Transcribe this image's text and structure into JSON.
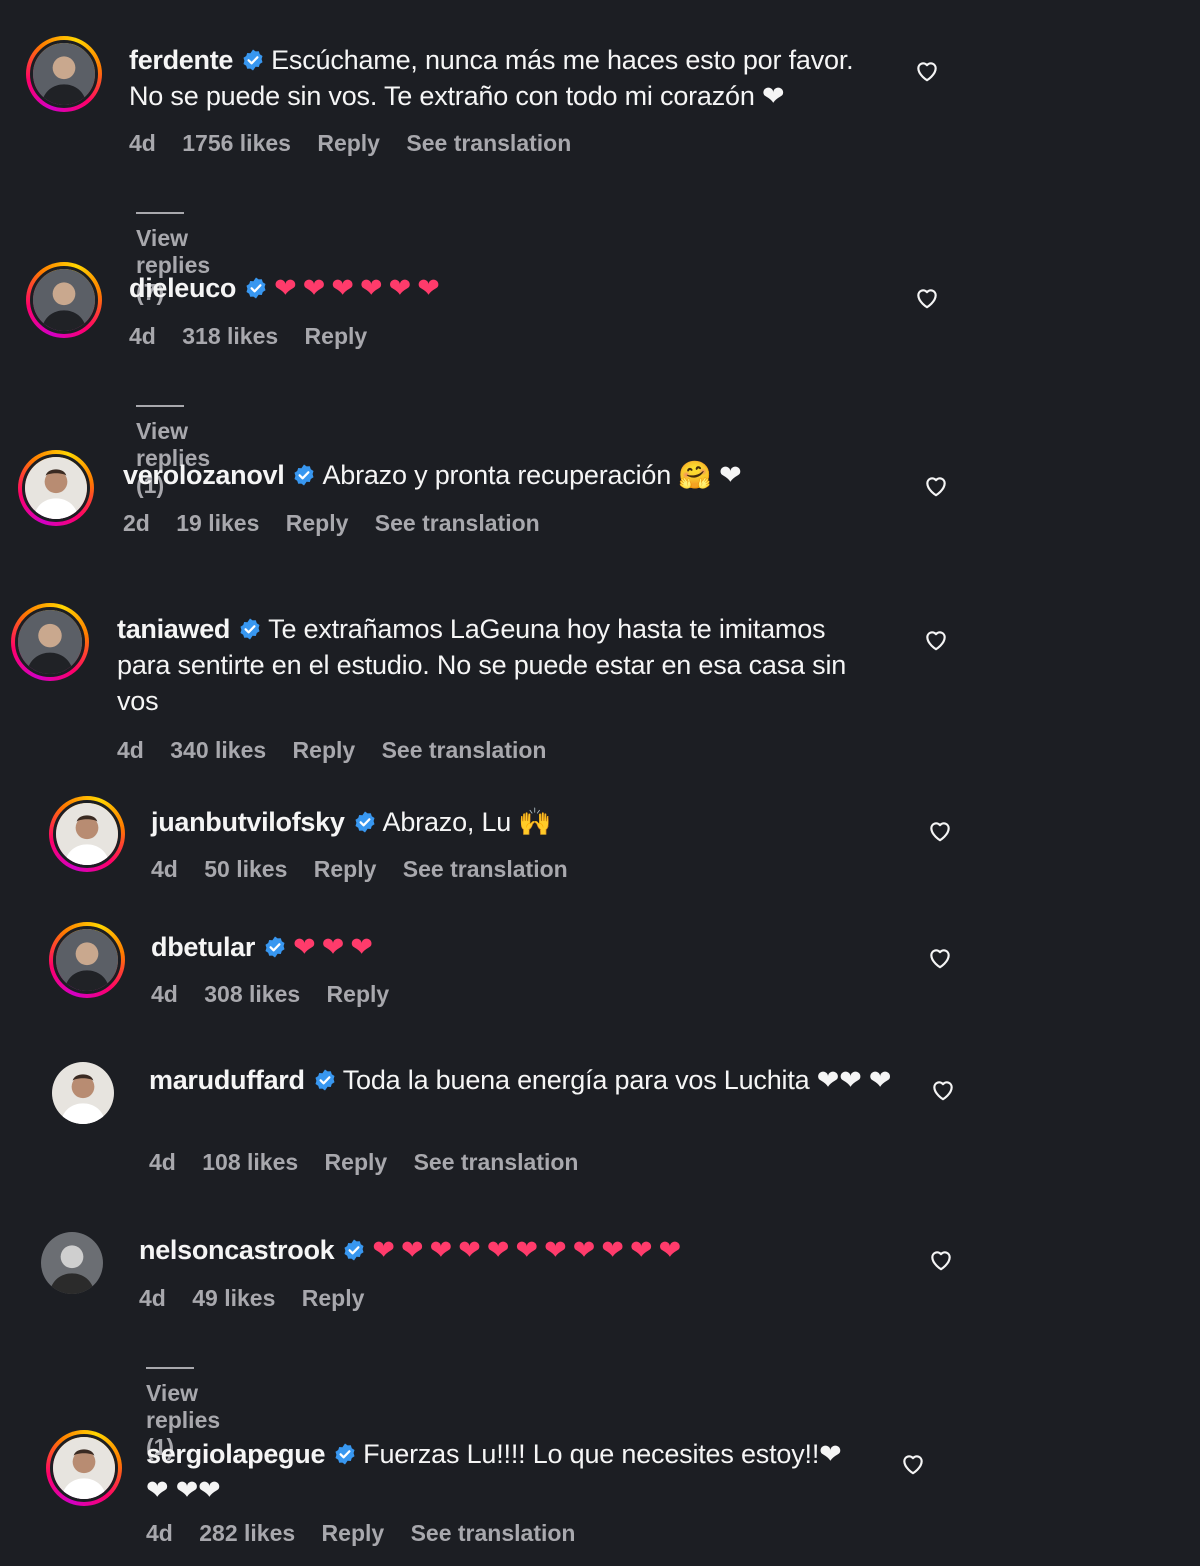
{
  "comments": [
    {
      "username": "ferdente",
      "text": "Escúchame, nunca más me haces esto por favor. No se puede sin vos. Te extraño con todo mi corazón ❤",
      "age": "4d",
      "likes": "1756 likes",
      "reply": "Reply",
      "translate": "See translation",
      "view_replies": "View replies (7)"
    },
    {
      "username": "dieleuco",
      "text": "❤❤❤❤❤❤",
      "age": "4d",
      "likes": "318 likes",
      "reply": "Reply",
      "view_replies": "View replies (1)"
    },
    {
      "username": "verolozanovl",
      "text": "Abrazo y pronta recuperación 🤗 ❤",
      "age": "2d",
      "likes": "19 likes",
      "reply": "Reply",
      "translate": "See translation"
    },
    {
      "username": "taniawed",
      "text": "Te extrañamos LaGeuna hoy hasta te imitamos para sentirte en el estudio. No se puede estar en esa casa sin vos",
      "age": "4d",
      "likes": "340 likes",
      "reply": "Reply",
      "translate": "See translation"
    },
    {
      "username": "juanbutvilofsky",
      "text": "Abrazo, Lu 🙌",
      "age": "4d",
      "likes": "50 likes",
      "reply": "Reply",
      "translate": "See translation"
    },
    {
      "username": "dbetular",
      "text": "❤❤❤",
      "age": "4d",
      "likes": "308 likes",
      "reply": "Reply"
    },
    {
      "username": "maruduffard",
      "text": "Toda la buena energía para vos Luchita ❤❤ ❤",
      "age": "4d",
      "likes": "108 likes",
      "reply": "Reply",
      "translate": "See translation"
    },
    {
      "username": "nelsoncastrook",
      "text": "❤❤❤❤❤❤❤❤❤❤❤",
      "age": "4d",
      "likes": "49 likes",
      "reply": "Reply",
      "view_replies": "View replies (1)"
    },
    {
      "username": "sergiolapegue",
      "text": "Fuerzas Lu!!!! Lo que necesites estoy!!❤ ❤ ❤❤",
      "age": "4d",
      "likes": "282 likes",
      "reply": "Reply",
      "translate": "See translation"
    }
  ],
  "icons": {
    "like": "heart-outline-icon",
    "verified": "verified-badge-icon"
  },
  "colors": {
    "background": "#1c1e23",
    "text": "#f5f5f5",
    "meta": "#a8a8ad",
    "verified": "#3897f0",
    "heart": "#ff3b6b"
  }
}
